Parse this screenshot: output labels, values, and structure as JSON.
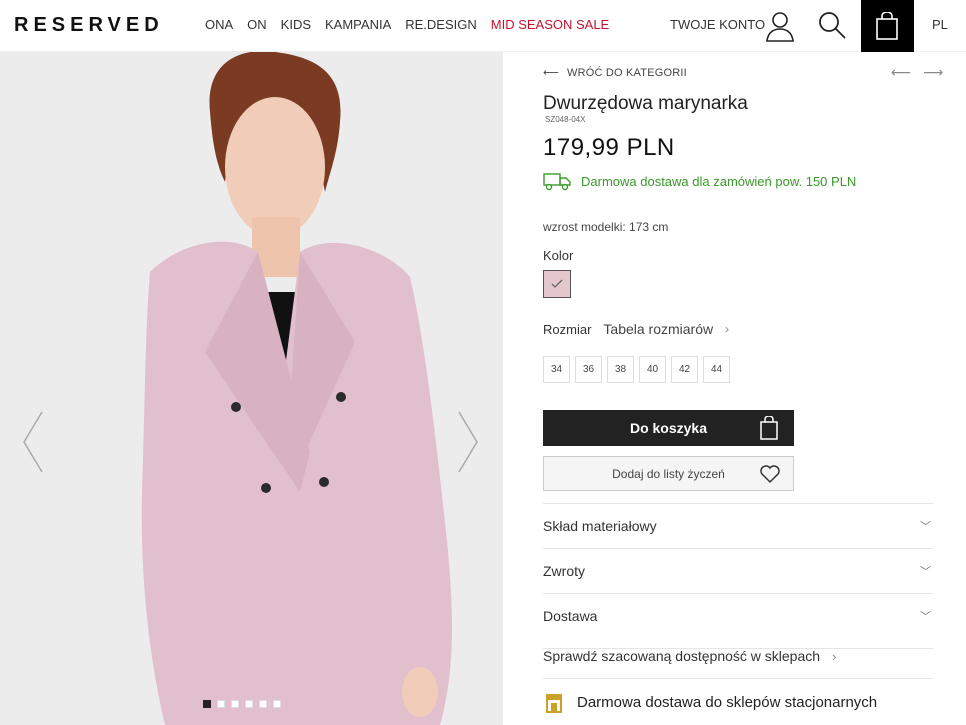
{
  "header": {
    "logo": "RESERVED",
    "nav": [
      "ONA",
      "ON",
      "KIDS",
      "KAMPANIA",
      "RE.DESIGN",
      "MID SEASON SALE"
    ],
    "account_label": "TWOJE KONTO",
    "language": "PL"
  },
  "gallery": {
    "dots_count": 6,
    "active_dot": 1
  },
  "product": {
    "back_label": "WRÓĆ DO KATEGORII",
    "title": "Dwurzędowa marynarka",
    "sku": "SZ048-04X",
    "price": "179,99 PLN",
    "delivery_text": "Darmowa dostawa dla zamówień pow. 150 PLN",
    "model_height": "wzrost modelki: 173 cm",
    "color_label": "Kolor",
    "swatch_color": "#e3c7cc",
    "size_label": "Rozmiar",
    "size_table_label": "Tabela rozmiarów",
    "sizes": [
      "34",
      "36",
      "38",
      "40",
      "42",
      "44"
    ],
    "add_to_cart": "Do koszyka",
    "add_to_wishlist": "Dodaj do listy życzeń",
    "accordions": [
      "Skład materiałowy",
      "Zwroty",
      "Dostawa"
    ],
    "check_stores": "Sprawdź szacowaną dostępność w sklepach",
    "store_delivery": "Darmowa dostawa do sklepów stacjonarnych"
  },
  "colors": {
    "sale": "#c8102e",
    "delivery_green": "#3a9a2a",
    "store_icon": "#c9a227"
  }
}
